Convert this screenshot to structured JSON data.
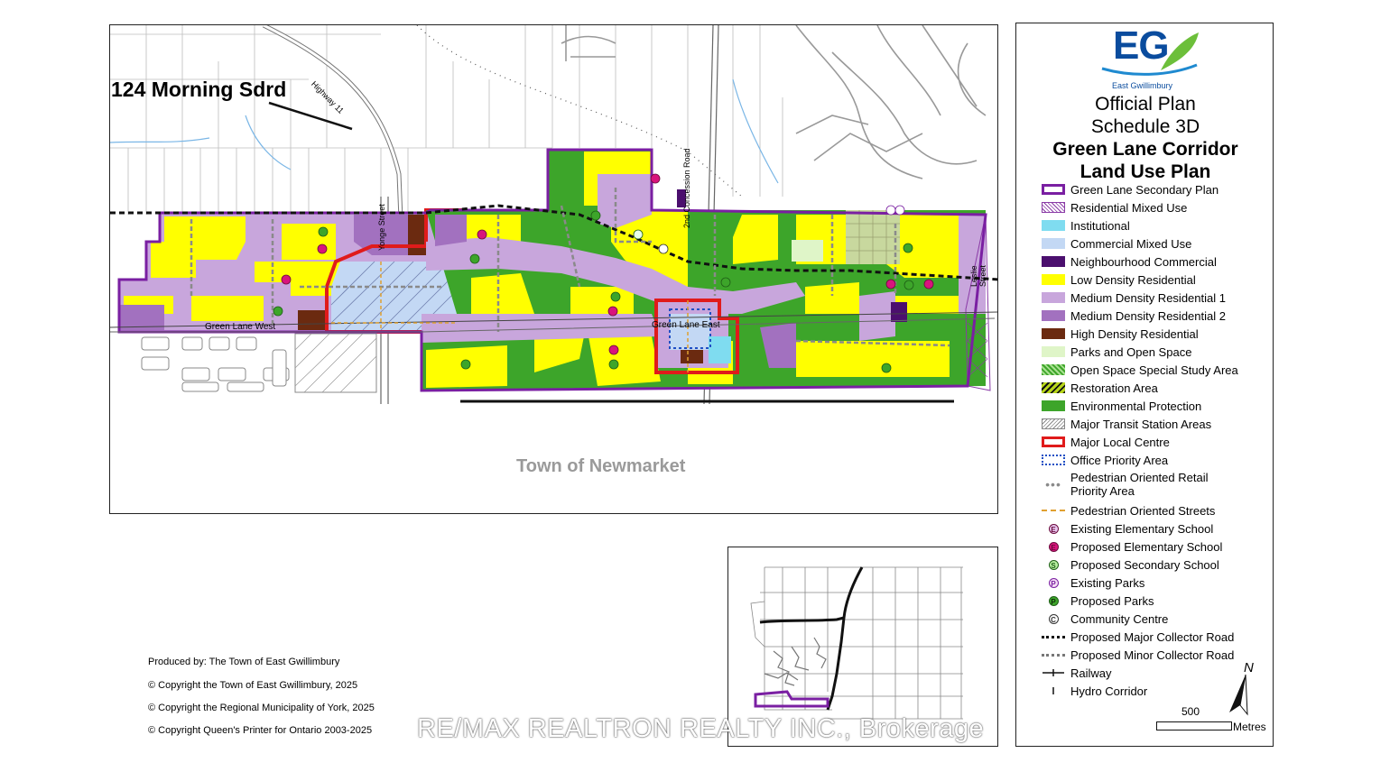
{
  "map": {
    "annotation": "124 Morning Sdrd",
    "road_labels": {
      "highway": "Highway 11",
      "yonge": "Yonge Street",
      "concession": "2nd Concession Road",
      "leslie": "Leslie Street",
      "green_lane_west": "Green Lane West",
      "green_lane_east": "Green Lane East"
    },
    "area_label": "Town of Newmarket"
  },
  "credits": [
    "Produced by: The Town of East Gwillimbury",
    "© Copyright the Town of East Gwillimbury, 2025",
    "© Copyright the Regional Municipality of York, 2025",
    "© Copyright Queen's Printer for Ontario 2003-2025"
  ],
  "legend": {
    "logo_text": "EG",
    "logo_subtitle": "East Gwillimbury",
    "title_line1": "Official Plan",
    "title_line2": "Schedule 3D",
    "title_line3": "Green Lane Corridor",
    "title_line4": "Land Use Plan",
    "items": [
      {
        "label": "Green Lane Secondary Plan",
        "color": "#7a1fa2"
      },
      {
        "label": "Residential Mixed Use",
        "color": "#8a3aa6"
      },
      {
        "label": "Institutional",
        "color": "#7fdcf0"
      },
      {
        "label": "Commercial Mixed Use",
        "color": "#c3d8f4"
      },
      {
        "label": "Neighbourhood Commercial",
        "color": "#4b0f6e"
      },
      {
        "label": "Low Density Residential",
        "color": "#ffff00"
      },
      {
        "label": "Medium Density Residential 1",
        "color": "#c8a6dc"
      },
      {
        "label": "Medium Density Residential 2",
        "color": "#a271bf"
      },
      {
        "label": "High Density Residential",
        "color": "#6b2a10"
      },
      {
        "label": "Parks and Open Space",
        "color": "#dff5c8"
      },
      {
        "label": "Open Space Special Study Area",
        "color": "#3da52a"
      },
      {
        "label": "Restoration Area",
        "color": "#b8d61a"
      },
      {
        "label": "Environmental Protection",
        "color": "#3da52a"
      },
      {
        "label": "Major Transit Station Areas",
        "color": "#888888"
      },
      {
        "label": "Major Local Centre",
        "color": "#e01b1b"
      },
      {
        "label": "Office Priority Area",
        "color": "#1f4fc4"
      },
      {
        "label": "Pedestrian Oriented Retail Priority Area",
        "color": "#8a8a8a"
      },
      {
        "label": "Pedestrian Oriented Streets",
        "color": "#e0a030"
      },
      {
        "label": "Existing Elementary School",
        "symbol": "E"
      },
      {
        "label": "Proposed Elementary School",
        "symbol": "E"
      },
      {
        "label": "Proposed Secondary School",
        "symbol": "S"
      },
      {
        "label": "Existing Parks",
        "symbol": "P"
      },
      {
        "label": "Proposed Parks",
        "symbol": "P"
      },
      {
        "label": "Community Centre",
        "symbol": "C"
      },
      {
        "label": "Proposed Major Collector Road",
        "color": "#111111"
      },
      {
        "label": "Proposed Minor Collector Road",
        "color": "#777777"
      },
      {
        "label": "Railway",
        "color": "#111111"
      },
      {
        "label": "Hydro Corridor",
        "color": "#111111"
      }
    ],
    "north_label": "N",
    "scale_value": "500",
    "scale_unit": "Metres"
  },
  "watermark": "RE/MAX REALTRON REALTY INC., Brokerage"
}
